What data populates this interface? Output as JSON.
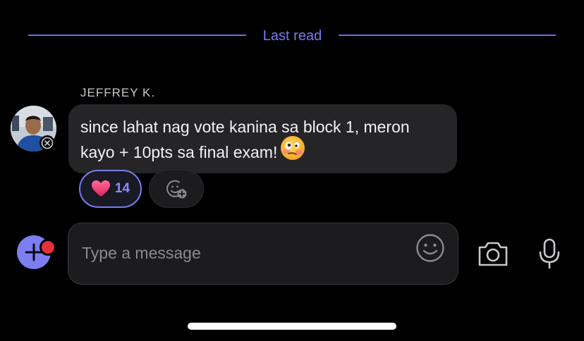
{
  "divider": {
    "label": "Last read"
  },
  "message": {
    "sender": "JEFFREY K.",
    "text": "since lahat nag vote kanina sa block 1, meron kayo + 10pts sa final exam!",
    "emoji_icon": "woozy-face-emoji"
  },
  "reactions": [
    {
      "icon": "heart-icon",
      "count": "14",
      "selected": true
    }
  ],
  "add_reaction": {
    "icon": "add-reaction-icon"
  },
  "composer": {
    "placeholder": "Type a message",
    "value": "",
    "plus_has_notification": true
  },
  "colors": {
    "accent": "#7b7cf0",
    "bubble": "#252527",
    "background": "#000000",
    "notification": "#e5323a"
  }
}
